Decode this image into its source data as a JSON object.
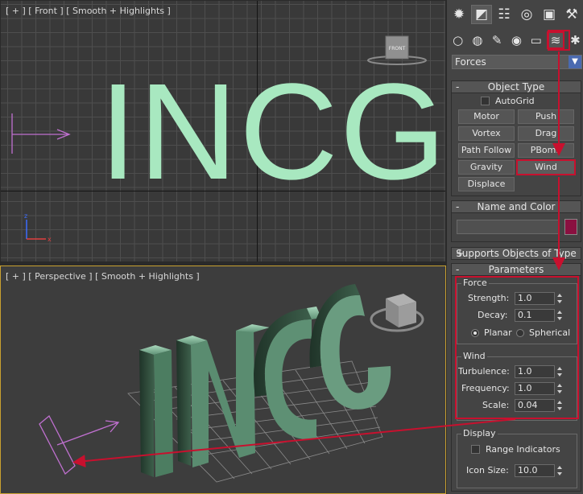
{
  "front_viewport": {
    "label_plus": "[ + ]",
    "label_view": "[ Front ]",
    "label_shading": "[ Smooth + Highlights ]",
    "text": "INCG",
    "viewcube_label": "FRONT"
  },
  "perspective_viewport": {
    "label_plus": "[ + ]",
    "label_view": "[ Perspective ]",
    "label_shading": "[ Smooth + Highlights ]",
    "text": "INCG"
  },
  "command_panel": {
    "main_tabs": [
      {
        "icon": "sun-icon",
        "glyph": "✹"
      },
      {
        "icon": "modify-icon",
        "glyph": "◩"
      },
      {
        "icon": "hierarchy-icon",
        "glyph": "☷"
      },
      {
        "icon": "motion-icon",
        "glyph": "◎"
      },
      {
        "icon": "display-icon",
        "glyph": "▣"
      },
      {
        "icon": "utilities-icon",
        "glyph": "⚒"
      }
    ],
    "sub_tabs": [
      {
        "icon": "geometry-icon",
        "glyph": "○"
      },
      {
        "icon": "shapes-icon",
        "glyph": "◍"
      },
      {
        "icon": "lights-icon",
        "glyph": "✎"
      },
      {
        "icon": "cameras-icon",
        "glyph": "◉"
      },
      {
        "icon": "helpers-icon",
        "glyph": "▭"
      },
      {
        "icon": "space-warps-icon",
        "glyph": "≋"
      },
      {
        "icon": "systems-icon",
        "glyph": "✱"
      }
    ],
    "category_dropdown": "Forces",
    "object_type": {
      "title": "Object Type",
      "sign": "-",
      "autogrid_label": "AutoGrid",
      "buttons": [
        "Motor",
        "Push",
        "Vortex",
        "Drag",
        "Path Follow",
        "PBomb",
        "Gravity",
        "Wind",
        "Displace"
      ]
    },
    "name_and_color": {
      "title": "Name and Color",
      "sign": "-",
      "swatch_color": "#8a1040"
    },
    "supports": {
      "title": "Supports Objects of Type",
      "sign": "+"
    },
    "parameters": {
      "title": "Parameters",
      "sign": "-",
      "force_group": "Force",
      "strength_label": "Strength:",
      "strength_value": "1.0",
      "decay_label": "Decay:",
      "decay_value": "0.1",
      "planar_label": "Planar",
      "spherical_label": "Spherical",
      "wind_group": "Wind",
      "turbulence_label": "Turbulence:",
      "turbulence_value": "1.0",
      "frequency_label": "Frequency:",
      "frequency_value": "1.0",
      "scale_label": "Scale:",
      "scale_value": "0.04",
      "display_group": "Display",
      "range_label": "Range Indicators",
      "icon_size_label": "Icon Size:",
      "icon_size_value": "10.0"
    }
  },
  "colors": {
    "text_mint": "#a8e8c0",
    "highlight_red": "#c8102e",
    "active_viewport_border": "#c8a030"
  }
}
